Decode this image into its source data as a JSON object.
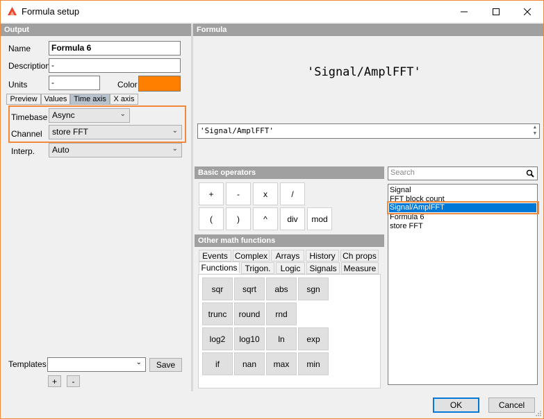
{
  "window": {
    "title": "Formula setup",
    "icon": "app-logo-icon"
  },
  "output": {
    "header": "Output",
    "name_label": "Name",
    "name_value": "Formula 6",
    "description_label": "Description",
    "description_value": "-",
    "units_label": "Units",
    "units_value": "-",
    "color_label": "Color",
    "color_value": "#ff8000",
    "tabs": [
      "Preview",
      "Values",
      "Time axis",
      "X axis"
    ],
    "active_tab": "Time axis",
    "timebase_label": "Timebase",
    "timebase_value": "Async",
    "channel_label": "Channel",
    "channel_value": "store FFT",
    "interp_label": "Interp.",
    "interp_value": "Auto",
    "templates_label": "Templates",
    "templates_value": "",
    "save_label": "Save",
    "add_label": "+",
    "remove_label": "-"
  },
  "formula": {
    "header": "Formula",
    "display": "'Signal/AmplFFT'",
    "input_value": "'Signal/AmplFFT'"
  },
  "basic_operators": {
    "header": "Basic operators",
    "row1": [
      "+",
      "-",
      "x",
      "/"
    ],
    "row2": [
      "(",
      ")",
      "^",
      "div",
      "mod"
    ]
  },
  "other_math": {
    "header": "Other math functions",
    "tabs_row1": [
      "Events",
      "Complex",
      "Arrays",
      "History",
      "Ch props"
    ],
    "tabs_row2": [
      "Functions",
      "Trigon.",
      "Logic",
      "Signals",
      "Measure"
    ],
    "active_tab": "Functions",
    "functions": [
      [
        "sqr",
        "sqrt",
        "abs",
        "sgn"
      ],
      [
        "trunc",
        "round",
        "rnd"
      ],
      [
        "log2",
        "log10",
        "ln",
        "exp"
      ],
      [
        "if",
        "nan",
        "max",
        "min"
      ]
    ]
  },
  "search": {
    "placeholder": "Search"
  },
  "channels": {
    "items": [
      "Signal",
      "FFT block count",
      "Signal/AmplFFT",
      "Formula 6",
      "store FFT"
    ],
    "selected": "Signal/AmplFFT"
  },
  "dialog": {
    "ok_label": "OK",
    "cancel_label": "Cancel"
  },
  "colors": {
    "accent_highlight": "#f08a3a",
    "selection": "#0078d7",
    "header_gray": "#a0a0a0"
  }
}
